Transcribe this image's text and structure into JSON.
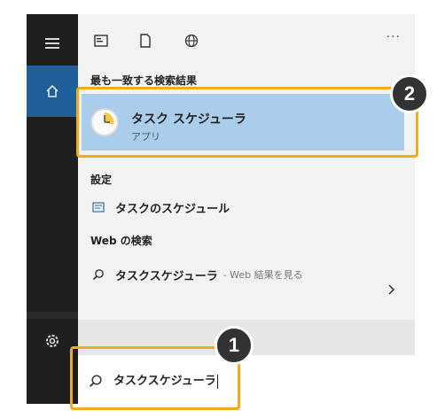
{
  "rail": {
    "icons": [
      "hamburger-menu-icon",
      "home-icon",
      "gear-icon"
    ]
  },
  "toolbar": {
    "icons": [
      "apps-icon",
      "document-icon",
      "web-globe-icon"
    ],
    "more_label": "···"
  },
  "sections": {
    "best_match_label": "最も一致する検索結果",
    "settings_label": "設定",
    "web_label": "Web の検索"
  },
  "best_match": {
    "name": "タスク スケジューラ",
    "type": "アプリ",
    "icon": "clock-icon"
  },
  "settings_item": {
    "label": "タスクのスケジュール",
    "icon": "settings-task-icon"
  },
  "web_item": {
    "label": "タスクスケジューラ",
    "suffix": "- Web 結果を見る",
    "icon": "search-icon"
  },
  "search": {
    "value": "タスクスケジューラ",
    "icon": "search-icon"
  },
  "callouts": {
    "step1": "1",
    "step2": "2",
    "color": "#f5a91c"
  },
  "colors": {
    "selection": "#a9cdea",
    "rail": "#1f1f1f",
    "rail_active": "#1f5f9a"
  }
}
